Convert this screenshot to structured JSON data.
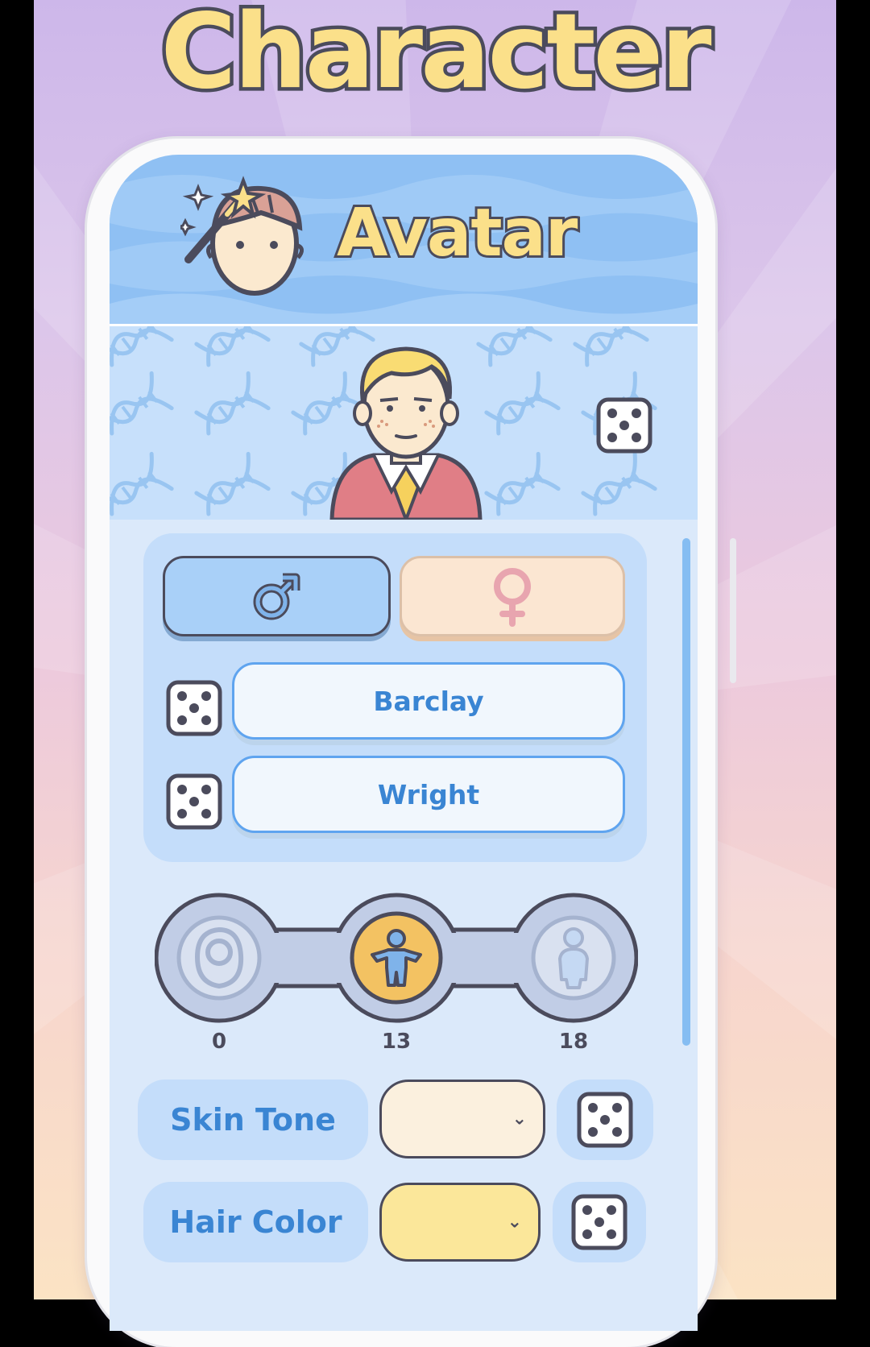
{
  "promo": {
    "title": "Character"
  },
  "app": {
    "header_title": "Avatar",
    "first_name": "Barclay",
    "last_name": "Wright",
    "age_stages": [
      {
        "name": "baby",
        "age": "0"
      },
      {
        "name": "child",
        "age": "13",
        "selected": true
      },
      {
        "name": "adult",
        "age": "18"
      }
    ],
    "options": [
      {
        "label": "Skin Tone",
        "swatch": "#fbf0de"
      },
      {
        "label": "Hair Color",
        "swatch": "#fbe79a"
      }
    ],
    "colors": {
      "header_blue": "#8fc0f3",
      "panel_blue": "#dbe9fa",
      "accent_blue": "#3a85d3",
      "title_yellow": "#fbe08a",
      "selected_stage": "#f3c262"
    },
    "icons": [
      "avatar-wand-icon",
      "dice-icon",
      "male-icon",
      "female-icon",
      "baby-icon",
      "child-icon",
      "adult-icon",
      "dna-icon",
      "chevron-down-icon"
    ]
  }
}
